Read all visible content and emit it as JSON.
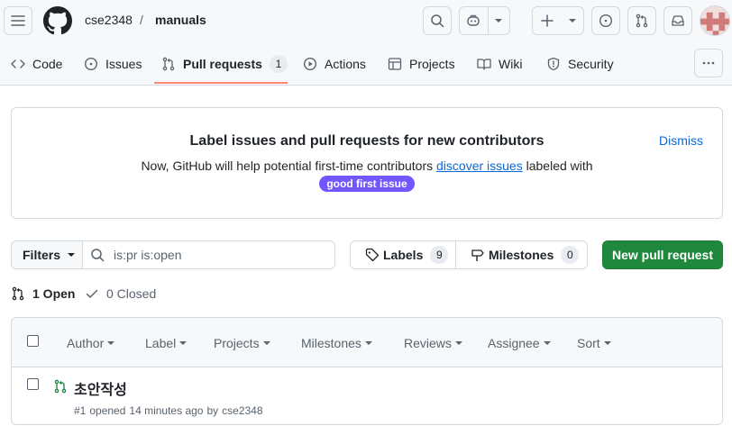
{
  "repo": {
    "owner": "cse2348",
    "separator": "/",
    "name": "manuals"
  },
  "header_icons": [
    "menu-icon",
    "github-logo-icon",
    "search-icon",
    "copilot-icon",
    "plus-icon",
    "issue-opened-icon",
    "pull-request-icon",
    "inbox-icon",
    "avatar"
  ],
  "tabs": [
    {
      "label": "Code"
    },
    {
      "label": "Issues"
    },
    {
      "label": "Pull requests",
      "count": "1"
    },
    {
      "label": "Actions"
    },
    {
      "label": "Projects"
    },
    {
      "label": "Wiki"
    },
    {
      "label": "Security"
    }
  ],
  "banner": {
    "title": "Label issues and pull requests for new contributors",
    "text_before": "Now, GitHub will help potential first-time contributors",
    "link": "discover issues",
    "text_after": "labeled with",
    "badge": "good first issue",
    "dismiss": "Dismiss"
  },
  "controls": {
    "filters": "Filters",
    "search_value": "is:pr is:open",
    "labels": "Labels",
    "labels_count": "9",
    "milestones": "Milestones",
    "milestones_count": "0",
    "new_pr": "New pull request"
  },
  "states": {
    "open": "1 Open",
    "closed": "0 Closed"
  },
  "list_filters": [
    "Author",
    "Label",
    "Projects",
    "Milestones",
    "Reviews",
    "Assignee",
    "Sort"
  ],
  "prs": [
    {
      "title": "초안작성",
      "number": "#1",
      "opened": "opened",
      "time": "14 minutes ago",
      "by": "by",
      "author": "cse2348"
    }
  ],
  "colors": {
    "accent": "#fd8c73",
    "green_button": "#1f883d",
    "badge": "#7057ff",
    "link": "#0969da",
    "open_icon": "#1a7f37"
  }
}
